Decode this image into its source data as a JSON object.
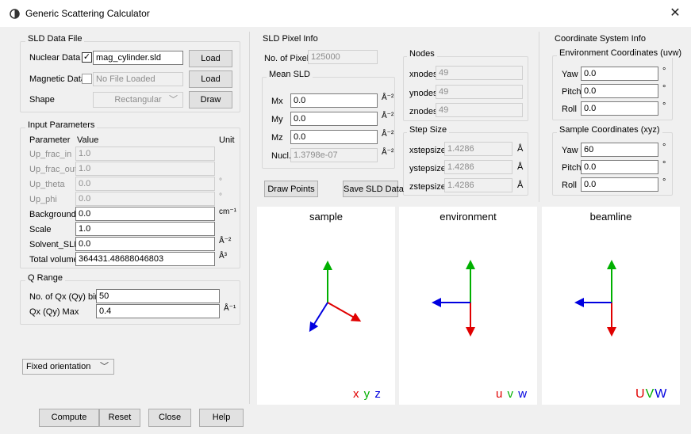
{
  "window": {
    "title": "Generic Scattering Calculator"
  },
  "sld_file": {
    "legend": "SLD Data File",
    "nuclear_label": "Nuclear Data",
    "nuclear_checked": true,
    "nuclear_value": "mag_cylinder.sld",
    "nuclear_load": "Load",
    "magnetic_label": "Magnetic Data",
    "magnetic_checked": false,
    "magnetic_value": "No File Loaded",
    "magnetic_load": "Load",
    "shape_label": "Shape",
    "shape_value": "Rectangular",
    "draw": "Draw"
  },
  "input_params": {
    "legend": "Input Parameters",
    "col_param": "Parameter",
    "col_value": "Value",
    "col_unit": "Unit",
    "rows": [
      {
        "name": "Up_frac_in",
        "value": "1.0",
        "unit": ""
      },
      {
        "name": "Up_frac_out",
        "value": "1.0",
        "unit": ""
      },
      {
        "name": "Up_theta",
        "value": "0.0",
        "unit": "°"
      },
      {
        "name": "Up_phi",
        "value": "0.0",
        "unit": "°"
      },
      {
        "name": "Background",
        "value": "0.0",
        "unit": "cm⁻¹"
      },
      {
        "name": "Scale",
        "value": "1.0",
        "unit": ""
      },
      {
        "name": "Solvent_SLD",
        "value": "0.0",
        "unit": "Å⁻²"
      },
      {
        "name": "Total volume",
        "value": "364431.48688046803",
        "unit": "Å³"
      }
    ]
  },
  "q_range": {
    "legend": "Q Range",
    "bins_label": "No. of Qx (Qy) bins",
    "bins_value": "50",
    "max_label": "Qx (Qy) Max",
    "max_value": "0.4",
    "max_unit": "Å⁻¹"
  },
  "orientation": {
    "value": "Fixed orientation"
  },
  "pixel_info": {
    "legend": "SLD Pixel Info",
    "num_pixels_label": "No. of Pixels",
    "num_pixels_value": "125000",
    "mean_sld_legend": "Mean SLD",
    "mx_label": "Mx",
    "mx_value": "0.0",
    "my_label": "My",
    "my_value": "0.0",
    "mz_label": "Mz",
    "mz_value": "0.0",
    "nucl_label": "Nucl.",
    "nucl_value": "1.3798e-07",
    "sld_unit": "Å⁻²",
    "nodes_legend": "Nodes",
    "xnodes_label": "xnodes",
    "xnodes_value": "49",
    "ynodes_label": "ynodes",
    "ynodes_value": "49",
    "znodes_label": "znodes",
    "znodes_value": "49",
    "step_legend": "Step Size",
    "xstep_label": "xstepsize",
    "xstep_value": "1.4286",
    "ystep_label": "ystepsize",
    "ystep_value": "1.4286",
    "zstep_label": "zstepsize",
    "zstep_value": "1.4286",
    "step_unit": "Å",
    "draw_points": "Draw Points",
    "save_sld": "Save SLD Data"
  },
  "coord_info": {
    "legend": "Coordinate System Info",
    "env_legend": "Environment Coordinates (uvw)",
    "env_yaw_label": "Yaw",
    "env_yaw_value": "0.0",
    "env_pitch_label": "Pitch",
    "env_pitch_value": "0.0",
    "env_roll_label": "Roll",
    "env_roll_value": "0.0",
    "sample_legend": "Sample Coordinates (xyz)",
    "s_yaw_label": "Yaw",
    "s_yaw_value": "60",
    "s_pitch_label": "Pitch",
    "s_pitch_value": "0.0",
    "s_roll_label": "Roll",
    "s_roll_value": "0.0",
    "deg": "°"
  },
  "plots": {
    "sample_title": "sample",
    "env_title": "environment",
    "beam_title": "beamline",
    "sample_axes": [
      "x",
      "y",
      "z"
    ],
    "env_axes": [
      "u",
      "v",
      "w"
    ],
    "beam_axes": [
      "U",
      "V",
      "W"
    ]
  },
  "colors": {
    "red": "#e00000",
    "green": "#00b000",
    "blue": "#0000e0"
  },
  "footer": {
    "compute": "Compute",
    "reset": "Reset",
    "close": "Close",
    "help": "Help"
  }
}
